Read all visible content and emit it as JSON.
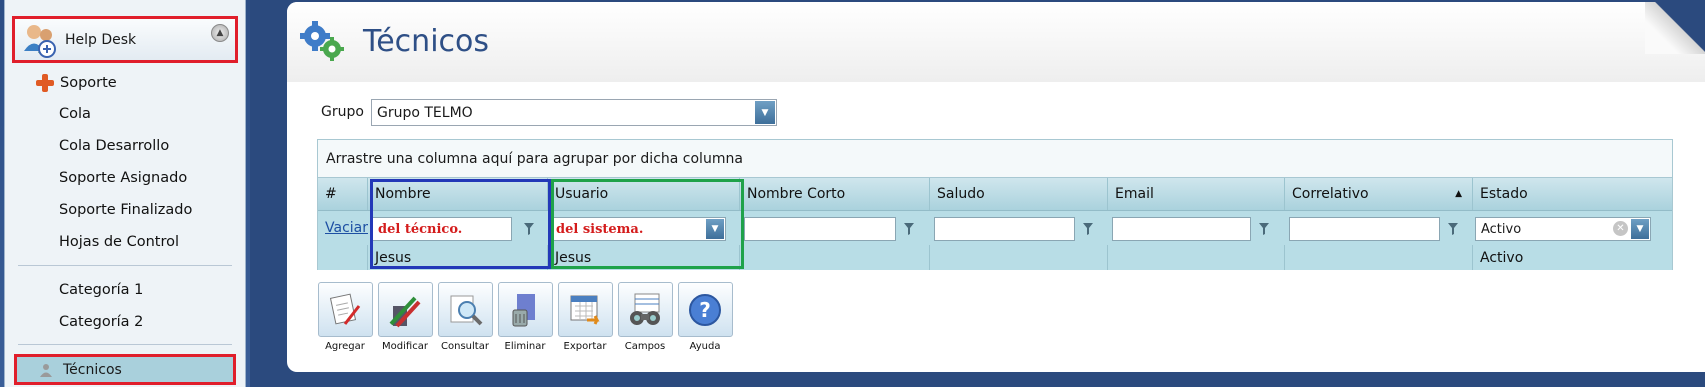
{
  "sidebar": {
    "header_label": "Help Desk",
    "items": [
      {
        "label": "Soporte"
      },
      {
        "label": "Cola"
      },
      {
        "label": "Cola Desarrollo"
      },
      {
        "label": "Soporte Asignado"
      },
      {
        "label": "Soporte Finalizado"
      },
      {
        "label": "Hojas de Control"
      },
      {
        "label": "Categoría 1"
      },
      {
        "label": "Categoría 2"
      },
      {
        "label": "Técnicos"
      }
    ]
  },
  "page": {
    "title": "Técnicos"
  },
  "filter": {
    "grupo_label": "Grupo",
    "grupo_value": "Grupo TELMO"
  },
  "grid": {
    "group_hint": "Arrastre una columna aquí para agrupar por dicha columna",
    "columns": [
      "#",
      "Nombre",
      "Usuario",
      "Nombre Corto",
      "Saludo",
      "Email",
      "Correlativo",
      "Estado"
    ],
    "filter_clear_label": "Vaciar",
    "filter_values": {
      "nombre": "del técnico.",
      "usuario": "del sistema.",
      "estado": "Activo"
    },
    "rows": [
      {
        "nombre": "Jesus",
        "usuario": "Jesus",
        "estado": "Activo"
      }
    ]
  },
  "toolbar": {
    "buttons": [
      {
        "label": "Agregar",
        "icon": "add-document-icon"
      },
      {
        "label": "Modificar",
        "icon": "edit-pencils-icon"
      },
      {
        "label": "Consultar",
        "icon": "magnifier-icon"
      },
      {
        "label": "Eliminar",
        "icon": "trash-icon"
      },
      {
        "label": "Exportar",
        "icon": "export-calendar-icon"
      },
      {
        "label": "Campos",
        "icon": "binoculars-icon"
      },
      {
        "label": "Ayuda",
        "icon": "help-icon"
      }
    ]
  },
  "colors": {
    "highlight_red": "#e01e2b",
    "highlight_blue": "#2338b8",
    "highlight_green": "#1fa24a",
    "title_blue": "#2e4f86",
    "grid_header": "#aad2dd"
  }
}
